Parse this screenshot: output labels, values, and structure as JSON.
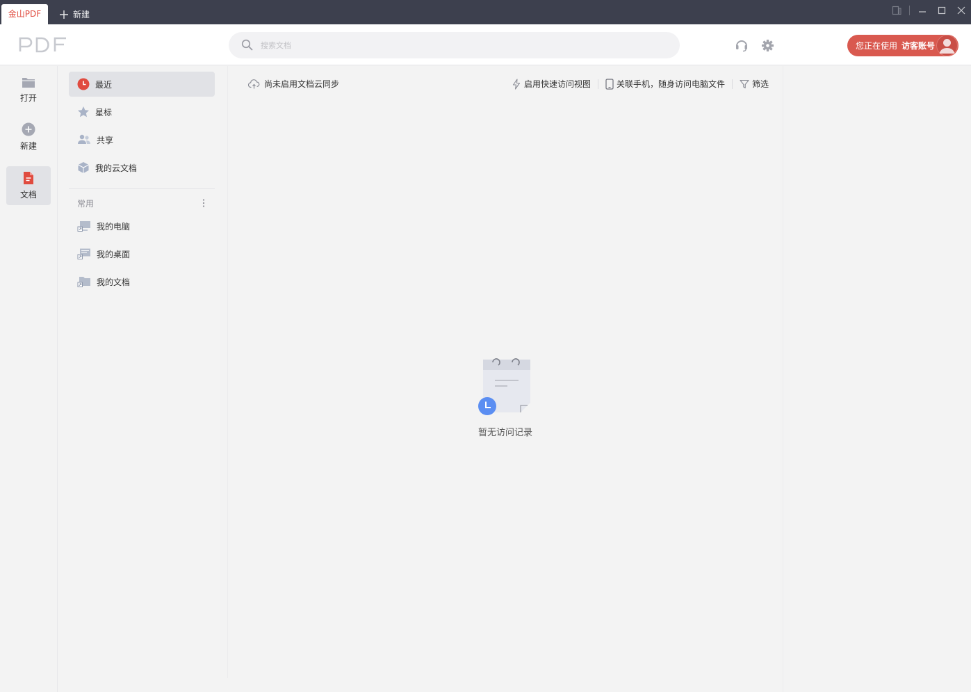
{
  "titlebar": {
    "active_tab": "金山PDF",
    "new_tab_label": "新建"
  },
  "header": {
    "logo_text": "PDF",
    "search_placeholder": "搜索文档",
    "account_prefix": "您正在使用",
    "account_name": "访客账号"
  },
  "leftnav": {
    "items": [
      {
        "label": "打开",
        "icon": "folder-icon"
      },
      {
        "label": "新建",
        "icon": "plus-circle-icon"
      },
      {
        "label": "文档",
        "icon": "document-icon",
        "active": true
      }
    ]
  },
  "sidebar": {
    "items": [
      {
        "label": "最近",
        "icon": "clock-icon",
        "active": true
      },
      {
        "label": "星标",
        "icon": "star-icon"
      },
      {
        "label": "共享",
        "icon": "users-icon"
      },
      {
        "label": "我的云文档",
        "icon": "cloud-box-icon"
      }
    ],
    "section_title": "常用",
    "shortcuts": [
      {
        "label": "我的电脑",
        "icon": "computer-shortcut-icon"
      },
      {
        "label": "我的桌面",
        "icon": "desktop-shortcut-icon"
      },
      {
        "label": "我的文档",
        "icon": "folder-shortcut-icon"
      }
    ]
  },
  "main": {
    "cloud_sync": "尚未启用文档云同步",
    "quick_view": "启用快速访问视图",
    "link_phone": "关联手机，随身访问电脑文件",
    "filter": "筛选",
    "empty_text": "暂无访问记录"
  },
  "colors": {
    "accent": "#d9594f",
    "titlebar": "#3d404e",
    "clock_badge": "#5b8ef2"
  }
}
